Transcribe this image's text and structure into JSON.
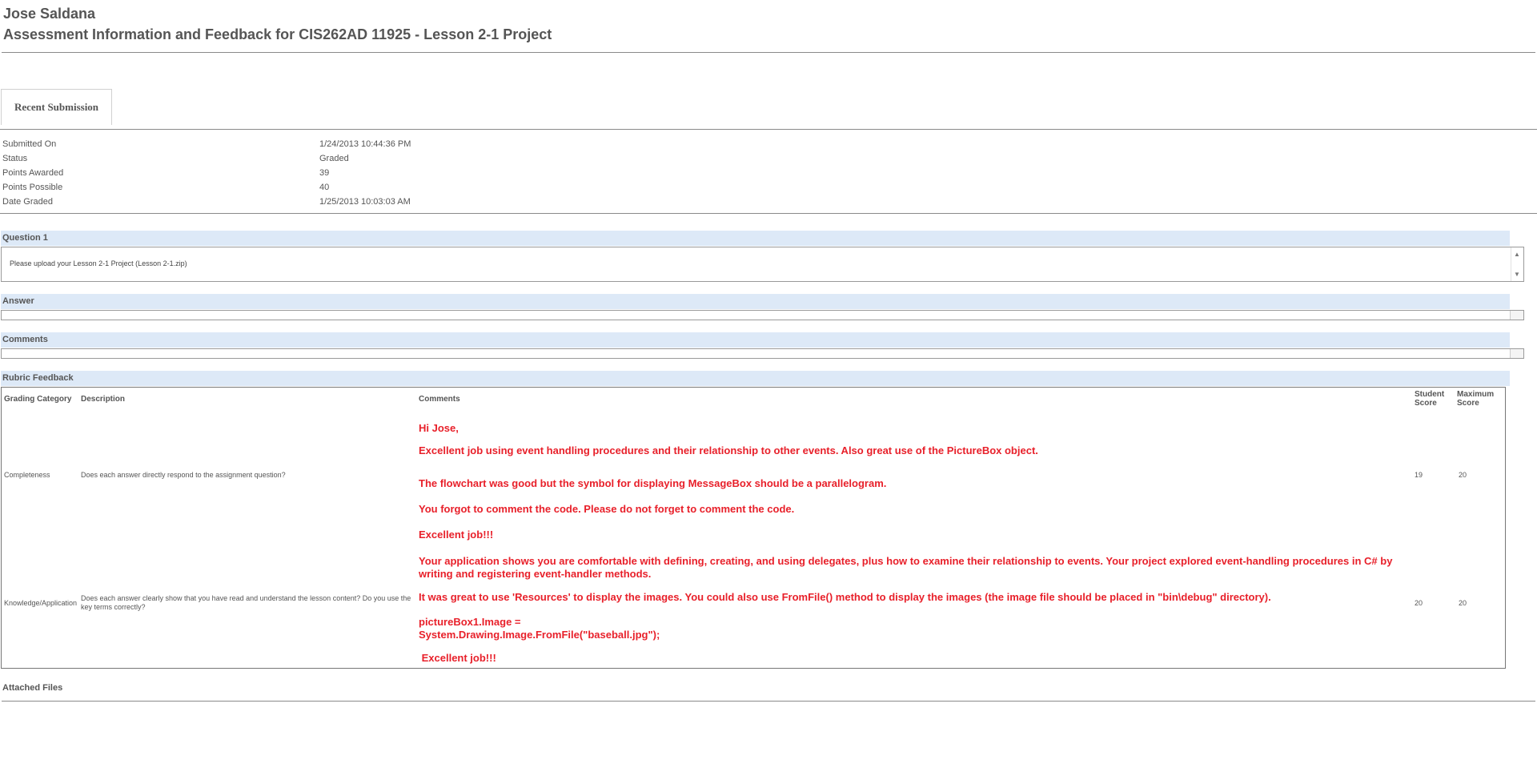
{
  "header": {
    "student_name": "Jose Saldana",
    "title": "Assessment Information and Feedback for CIS262AD 11925 - Lesson 2-1 Project"
  },
  "tabs": [
    {
      "label": "Recent Submission"
    }
  ],
  "submission": {
    "rows": [
      {
        "label": "Submitted On",
        "value": "1/24/2013 10:44:36 PM"
      },
      {
        "label": "Status",
        "value": "Graded"
      },
      {
        "label": "Points Awarded",
        "value": "39"
      },
      {
        "label": "Points Possible",
        "value": "40"
      },
      {
        "label": "Date Graded",
        "value": "1/25/2013 10:03:03 AM"
      }
    ]
  },
  "question": {
    "heading": "Question 1",
    "text": "Please upload your Lesson 2-1 Project (Lesson 2-1.zip)"
  },
  "answer": {
    "heading": "Answer",
    "value": ""
  },
  "comments": {
    "heading": "Comments",
    "value": ""
  },
  "rubric": {
    "heading": "Rubric Feedback",
    "columns": {
      "category": "Grading Category",
      "description": "Description",
      "comments": "Comments",
      "student_score": "Student Score",
      "max_score": "Maximum Score"
    },
    "rows": [
      {
        "category": "Completeness",
        "description": "Does each answer directly respond to the assignment question?",
        "student_score": "19",
        "max_score": "20",
        "comments": [
          "Hi Jose,",
          "Excellent job using event handling procedures and their relationship to other events. Also great use of the PictureBox object.",
          "The flowchart was good but the symbol for displaying MessageBox should be a parallelogram.",
          "You forgot to comment the code. Please do not forget to comment the code.",
          "Excellent job!!!"
        ]
      },
      {
        "category": "Knowledge/Application",
        "description": "Does each answer clearly show that you have read and understand the lesson content? Do you use the key terms correctly?",
        "student_score": "20",
        "max_score": "20",
        "comments": [
          "Your application shows you are comfortable with defining, creating, and using delegates, plus how to examine their relationship to events. Your project explored event-handling procedures in C# by writing and registering event-handler methods.",
          "It was great to use 'Resources' to display the images. You could also use FromFile() method to display the images (the image file should be placed in \"bin\\debug\" directory).",
          "pictureBox1.Image = System.Drawing.Image.FromFile(\"baseball.jpg\");",
          " Excellent job!!!"
        ]
      }
    ]
  },
  "attached_files": {
    "heading": "Attached Files"
  },
  "colors": {
    "accent_bar": "#dde9f7",
    "feedback_red": "#e8202a"
  }
}
